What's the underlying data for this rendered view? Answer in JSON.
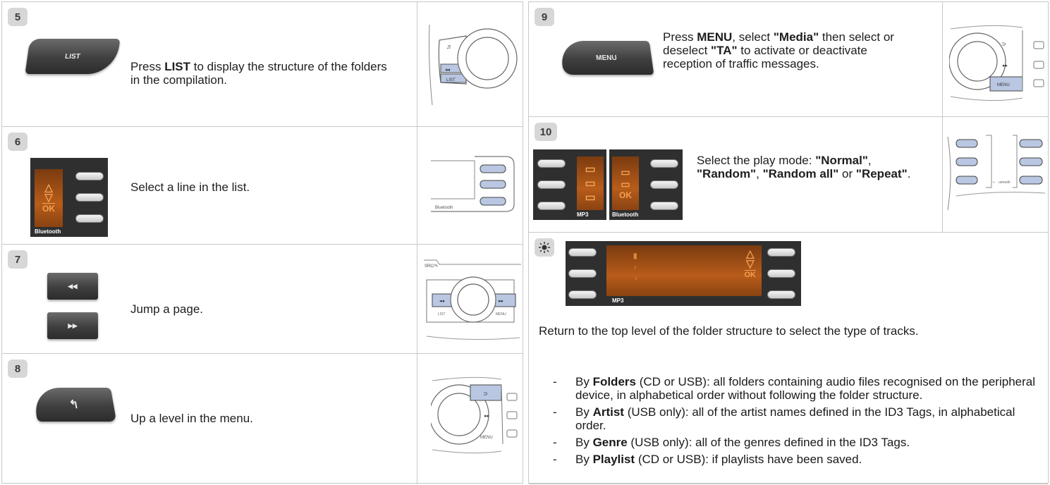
{
  "steps": {
    "s5": {
      "number": "5",
      "key_label": "LIST",
      "text_before": "Press ",
      "text_bold": "LIST",
      "text_after": " to display the structure of the folders in the compilation."
    },
    "s6": {
      "number": "6",
      "screen_ok": "OK",
      "bluetooth": "Bluetooth",
      "text": "Select a line in the list."
    },
    "s7": {
      "number": "7",
      "rewind_icon": "◂◂",
      "forward_icon": "▸▸",
      "text": "Jump a page."
    },
    "s8": {
      "number": "8",
      "back_icon": "↰",
      "text": "Up a level in the menu."
    },
    "s9": {
      "number": "9",
      "key_label": "MENU",
      "t1": "Press ",
      "b1": "MENU",
      "t2": ", select ",
      "b2": "\"Media\"",
      "t3": " then select or deselect ",
      "b3": "\"TA\"",
      "t4": " to activate or deactivate reception of traffic messages."
    },
    "s10": {
      "number": "10",
      "screen_ok": "OK",
      "mp3": "MP3",
      "bluetooth": "Bluetooth",
      "t1": "Select the play mode: ",
      "b1": "\"Normal\"",
      "t2": ", ",
      "b2": "\"Random\"",
      "t3": ", ",
      "b3": "\"Random all\"",
      "t4": " or ",
      "b4": "\"Repeat\"",
      "t5": "."
    },
    "tip": {
      "intro": "Return to the top level of the folder structure to select the type of tracks.",
      "bullets": [
        {
          "dash": "-",
          "pre": "By ",
          "bold": "Folders",
          "post": " (CD or USB): all folders containing audio files recognised on the peripheral device, in alphabetical order without following the folder structure."
        },
        {
          "dash": "-",
          "pre": "By ",
          "bold": "Artist",
          "post": " (USB only): all of the artist names defined in the ID3 Tags, in alphabetical order."
        },
        {
          "dash": "-",
          "pre": "By ",
          "bold": "Genre",
          "post": " (USB only): all of the genres defined in the ID3 Tags."
        },
        {
          "dash": "-",
          "pre": "By ",
          "bold": "Playlist",
          "post": " (CD or USB): if playlists have been saved."
        }
      ],
      "screen_ok": "OK",
      "mp3": "MP3"
    },
    "sketch_labels": {
      "list": "LIST",
      "menu": "MENU",
      "src": "SRC/"
    }
  },
  "colors": {
    "border": "#c8c8c8",
    "badge": "#d7d7d7",
    "screen_orange": "#b85c1a",
    "key_dark": "#3f3f3f"
  }
}
